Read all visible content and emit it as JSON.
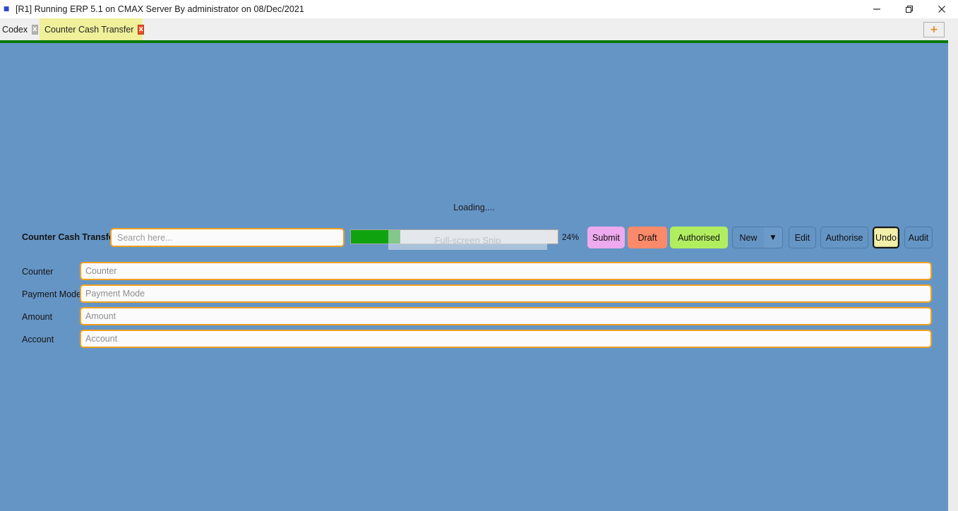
{
  "window": {
    "app_icon": "app-icon",
    "title": "[R1] Running ERP 5.1 on CMAX Server By administrator on 08/Dec/2021",
    "minimize_label": "minimize-icon",
    "maximize_label": "restore-icon",
    "close_label": "close-icon"
  },
  "tabs": {
    "items": [
      {
        "label": "Codex",
        "active": false,
        "close": "x"
      },
      {
        "label": "Counter Cash Transfer",
        "active": true,
        "close": "x"
      }
    ],
    "add_label": "+"
  },
  "content": {
    "loading_text": "Loading...."
  },
  "toolbar": {
    "module_label": "Counter Cash Transfer",
    "search_placeholder": "Search here...",
    "search_value": "",
    "progress_percent_label": "24%",
    "progress_percent": 24,
    "snip_overlay_text": "Full-screen Snip",
    "buttons": {
      "submit": "Submit",
      "draft": "Draft",
      "authorised": "Authorised",
      "new": "New",
      "new_arrow": "▼",
      "edit": "Edit",
      "authorise": "Authorise",
      "undo": "Undo",
      "audit": "Audit"
    }
  },
  "form": {
    "fields": [
      {
        "label": "Counter",
        "placeholder": "Counter",
        "value": ""
      },
      {
        "label": "Payment Mode",
        "placeholder": "Payment Mode",
        "value": ""
      },
      {
        "label": "Amount",
        "placeholder": "Amount",
        "value": ""
      },
      {
        "label": "Account",
        "placeholder": "Account",
        "value": ""
      }
    ]
  },
  "colors": {
    "content_bg": "#6595c5",
    "accent_border": "#f0a020",
    "green_bar": "#0a7a0a",
    "progress_fill": "#10a310",
    "tab_active_bg": "#eff099",
    "submit_bg": "#eeaaee",
    "draft_bg": "#fa8a6a",
    "authorised_bg": "#b0ee60",
    "undo_bg": "#f2f0a8"
  }
}
